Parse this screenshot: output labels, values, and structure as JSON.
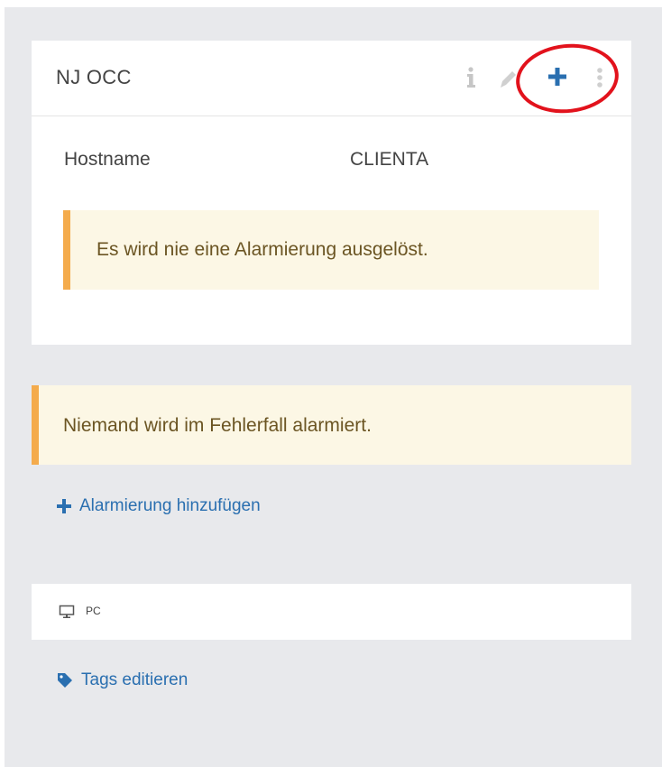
{
  "card": {
    "title": "NJ OCC",
    "icons": [
      "info-icon",
      "pencil-icon",
      "plus-icon",
      "more-vertical-icon"
    ],
    "hostname_label": "Hostname",
    "hostname_value": "CLIENTA",
    "alert_text": "Es wird nie eine Alarmierung ausgelöst."
  },
  "notice": {
    "text": "Niemand wird im Fehlerfall alarmiert."
  },
  "add_alarm": {
    "icon": "plus-icon",
    "label": "Alarmierung hinzufügen"
  },
  "device": {
    "icon": "monitor-icon",
    "label": "PC"
  },
  "tags": {
    "icon": "tag-icon",
    "label": "Tags editieren"
  },
  "colors": {
    "background": "#e8e9ec",
    "card": "#ffffff",
    "alert_bg": "#fcf7e5",
    "alert_border": "#f4ab4c",
    "alert_text": "#6b5523",
    "link": "#2a6fb0",
    "highlight": "#e2121c"
  }
}
